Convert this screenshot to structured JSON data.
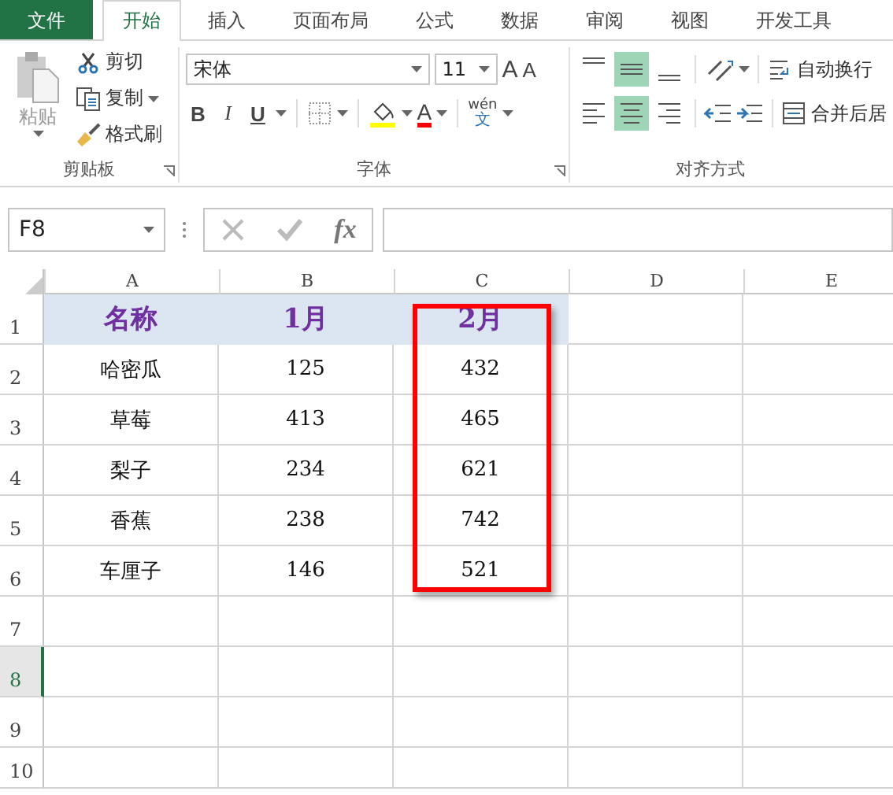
{
  "tabs": [
    {
      "label": "文件",
      "kind": "file",
      "selected": false
    },
    {
      "label": "开始",
      "kind": "tab",
      "selected": true
    },
    {
      "label": "插入",
      "kind": "tab",
      "selected": false
    },
    {
      "label": "页面布局",
      "kind": "tab",
      "selected": false
    },
    {
      "label": "公式",
      "kind": "tab",
      "selected": false
    },
    {
      "label": "数据",
      "kind": "tab",
      "selected": false
    },
    {
      "label": "审阅",
      "kind": "tab",
      "selected": false
    },
    {
      "label": "视图",
      "kind": "tab",
      "selected": false
    },
    {
      "label": "开发工具",
      "kind": "tab",
      "selected": false
    }
  ],
  "ribbon": {
    "clipboard": {
      "paste": "粘贴",
      "cut": "剪切",
      "copy": "复制",
      "format_painter": "格式刷",
      "label": "剪贴板"
    },
    "font": {
      "font_name": "宋体",
      "font_size": "11",
      "grow": "A",
      "shrink": "A",
      "bold": "B",
      "italic": "I",
      "underline": "U",
      "font_color": "A",
      "phonetic": "wén",
      "phonetic_char": "文",
      "label": "字体"
    },
    "alignment": {
      "vertical": [
        {
          "kind": "top",
          "selected": false
        },
        {
          "kind": "middle",
          "selected": true
        },
        {
          "kind": "bottom",
          "selected": false
        }
      ],
      "horizontal": [
        {
          "kind": "left",
          "selected": false
        },
        {
          "kind": "center",
          "selected": true
        },
        {
          "kind": "right",
          "selected": false
        }
      ],
      "wrap_text": "自动换行",
      "merge": "合并后居",
      "label": "对齐方式"
    }
  },
  "formula_bar": {
    "name_box": "F8",
    "function_label": "fx"
  },
  "sheet": {
    "columns": [
      {
        "label": "A",
        "highlighted": false
      },
      {
        "label": "B",
        "highlighted": false
      },
      {
        "label": "C",
        "highlighted": true
      },
      {
        "label": "D",
        "highlighted": false
      },
      {
        "label": "E",
        "highlighted": false
      }
    ],
    "rows": [
      {
        "number": "1",
        "selected": false,
        "header": true,
        "cells": [
          "名称",
          "1月",
          "2月"
        ]
      },
      {
        "number": "2",
        "selected": false,
        "header": false,
        "cells": [
          "哈密瓜",
          "125",
          "432"
        ]
      },
      {
        "number": "3",
        "selected": false,
        "header": false,
        "cells": [
          "草莓",
          "413",
          "465"
        ]
      },
      {
        "number": "4",
        "selected": false,
        "header": false,
        "cells": [
          "梨子",
          "234",
          "621"
        ]
      },
      {
        "number": "5",
        "selected": false,
        "header": false,
        "cells": [
          "香蕉",
          "238",
          "742"
        ]
      },
      {
        "number": "6",
        "selected": false,
        "header": false,
        "cells": [
          "车厘子",
          "146",
          "521"
        ]
      },
      {
        "number": "7",
        "selected": false,
        "header": false,
        "cells": []
      },
      {
        "number": "8",
        "selected": true,
        "header": false,
        "cells": []
      },
      {
        "number": "9",
        "selected": false,
        "header": false,
        "cells": []
      },
      {
        "number": "10",
        "selected": false,
        "header": false,
        "cells": []
      }
    ]
  }
}
